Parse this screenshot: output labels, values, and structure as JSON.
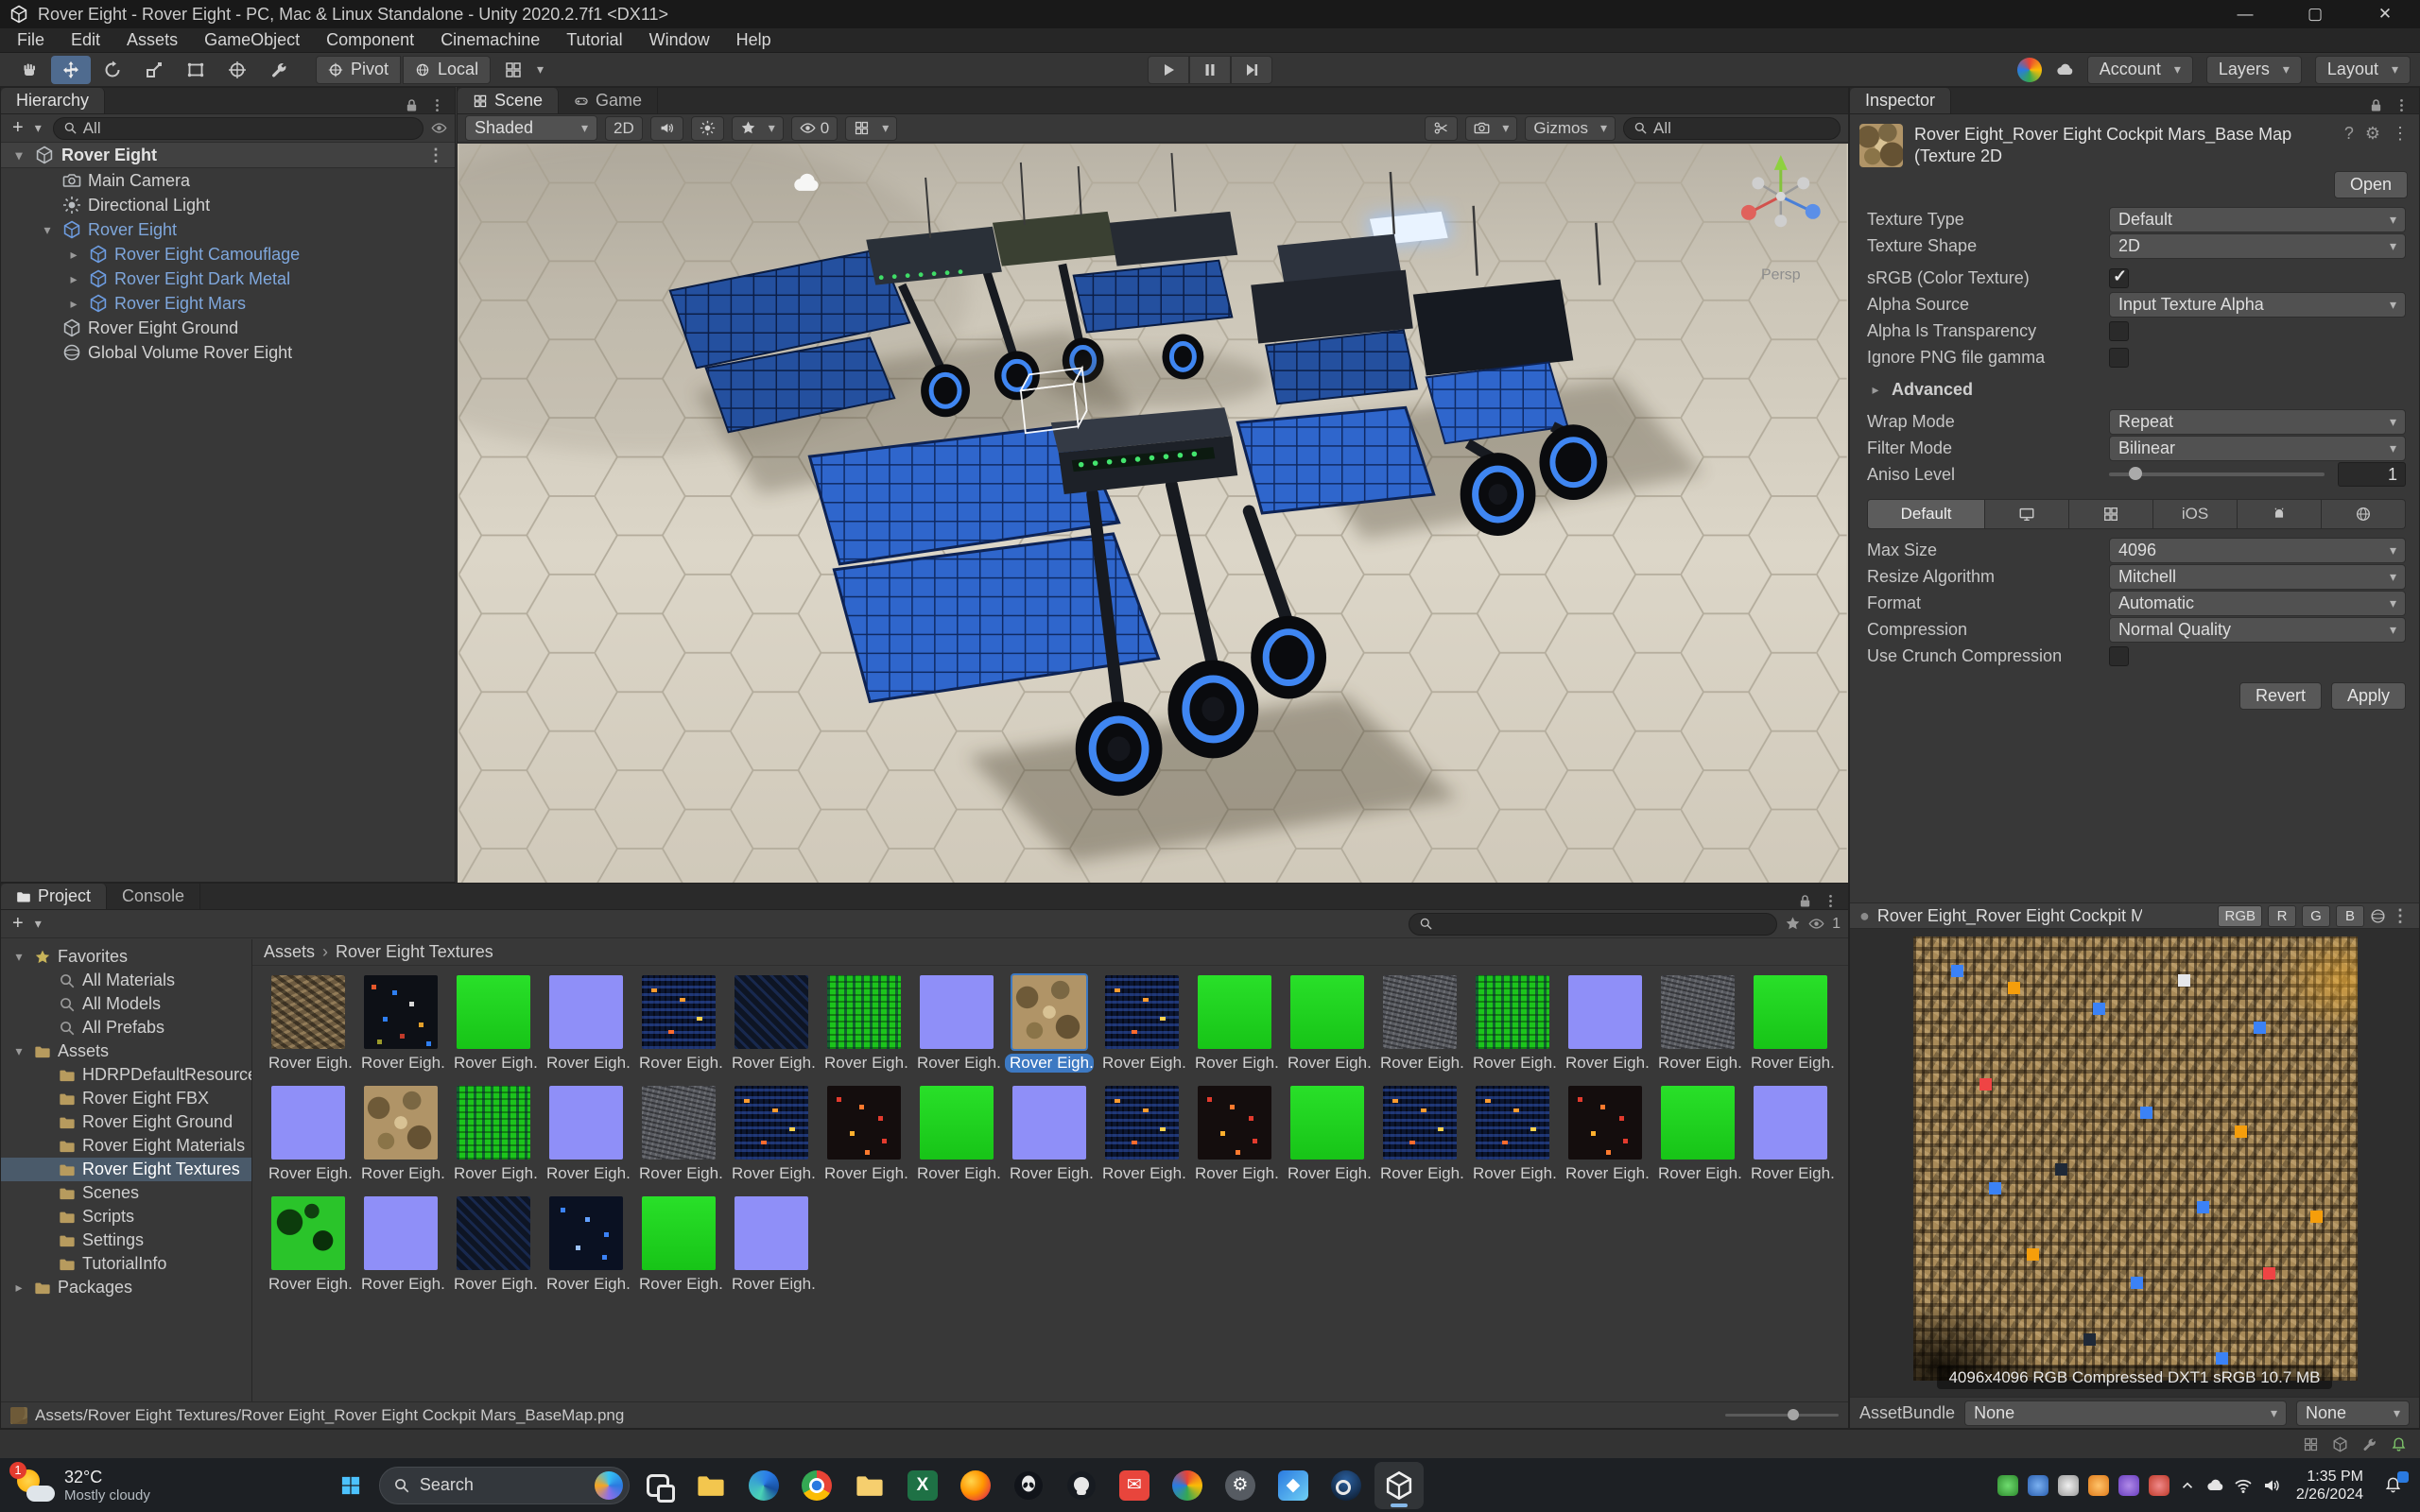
{
  "window": {
    "title": "Rover Eight - Rover Eight - PC, Mac & Linux Standalone - Unity 2020.2.7f1 <DX11>"
  },
  "menu": {
    "items": [
      "File",
      "Edit",
      "Assets",
      "GameObject",
      "Component",
      "Cinemachine",
      "Tutorial",
      "Window",
      "Help"
    ]
  },
  "toolbar": {
    "pivot": "Pivot",
    "local": "Local",
    "account": "Account",
    "layers": "Layers",
    "layout": "Layout"
  },
  "hierarchy": {
    "tab": "Hierarchy",
    "search_value": "All",
    "scene_name": "Rover Eight",
    "items": [
      {
        "label": "Main Camera",
        "icon": "camera",
        "depth": 1,
        "expander": "none",
        "prefab": false
      },
      {
        "label": "Directional Light",
        "icon": "light",
        "depth": 1,
        "expander": "none",
        "prefab": false
      },
      {
        "label": "Rover Eight",
        "icon": "cube",
        "depth": 1,
        "expander": "open",
        "prefab": true
      },
      {
        "label": "Rover Eight Camouflage",
        "icon": "cube",
        "depth": 2,
        "expander": "closed",
        "prefab": true
      },
      {
        "label": "Rover Eight Dark Metal",
        "icon": "cube",
        "depth": 2,
        "expander": "closed",
        "prefab": true
      },
      {
        "label": "Rover Eight Mars",
        "icon": "cube",
        "depth": 2,
        "expander": "closed",
        "prefab": true
      },
      {
        "label": "Rover Eight Ground",
        "icon": "cube",
        "depth": 1,
        "expander": "none",
        "prefab": false
      },
      {
        "label": "Global Volume Rover Eight",
        "icon": "sphere",
        "depth": 1,
        "expander": "none",
        "prefab": false
      }
    ]
  },
  "scene": {
    "tab_scene": "Scene",
    "tab_game": "Game",
    "shading": "Shaded",
    "toggle_2d": "2D",
    "fx_count": "0",
    "gizmos": "Gizmos",
    "search_value": "All",
    "persp_label": "Persp"
  },
  "inspector": {
    "tab": "Inspector",
    "title": "Rover Eight_Rover Eight Cockpit Mars_Base Map (Texture 2D",
    "open_button": "Open",
    "texture_type_label": "Texture Type",
    "texture_type": "Default",
    "texture_shape_label": "Texture Shape",
    "texture_shape": "2D",
    "srgb_label": "sRGB (Color Texture)",
    "alpha_source_label": "Alpha Source",
    "alpha_source": "Input Texture Alpha",
    "alpha_transparency_label": "Alpha Is Transparency",
    "ignore_png_label": "Ignore PNG file gamma",
    "advanced_label": "Advanced",
    "wrap_mode_label": "Wrap Mode",
    "wrap_mode": "Repeat",
    "filter_mode_label": "Filter Mode",
    "filter_mode": "Bilinear",
    "aniso_label": "Aniso Level",
    "aniso_value": "1",
    "platform_default": "Default",
    "max_size_label": "Max Size",
    "max_size": "4096",
    "resize_label": "Resize Algorithm",
    "resize": "Mitchell",
    "format_label": "Format",
    "format": "Automatic",
    "compression_label": "Compression",
    "compression": "Normal Quality",
    "crunch_label": "Use Crunch Compression",
    "revert": "Revert",
    "apply": "Apply"
  },
  "preview": {
    "title": "Rover Eight_Rover Eight Cockpit Ma",
    "channels": [
      "RGB",
      "R",
      "G",
      "B"
    ],
    "caption": "4096x4096  RGB Compressed DXT1 sRGB  10.7 MB",
    "assetbundle_label": "AssetBundle",
    "assetbundle_value": "None",
    "assetbundle_variant": "None"
  },
  "project": {
    "tab_project": "Project",
    "tab_console": "Console",
    "favorites_label": "Favorites",
    "favorites": [
      "All Materials",
      "All Models",
      "All Prefabs"
    ],
    "assets_label": "Assets",
    "folders": [
      "HDRPDefaultResources",
      "Rover Eight FBX",
      "Rover Eight Ground",
      "Rover Eight Materials",
      "Rover Eight Textures",
      "Scenes",
      "Scripts",
      "Settings",
      "TutorialInfo"
    ],
    "selected_folder": "Rover Eight Textures",
    "packages_label": "Packages",
    "breadcrumb_root": "Assets",
    "breadcrumb_current": "Rover Eight Textures",
    "item_label": "Rover Eigh...",
    "hidden_count": "1",
    "grid_variants": [
      "rock",
      "darkdots",
      "green",
      "purple",
      "bluetech",
      "darkblue",
      "greentech",
      "purple",
      "camo",
      "bluetech",
      "green",
      "green",
      "noise",
      "greentech",
      "purple",
      "noise",
      "green",
      "purple",
      "camo",
      "greentech",
      "purple",
      "noise",
      "bluetech",
      "reddots",
      "green",
      "purple",
      "bluetech",
      "reddots",
      "green",
      "bluetech",
      "bluetech",
      "reddots",
      "green",
      "purple",
      "greencamo",
      "purple",
      "darkblue",
      "bluedots",
      "green",
      "purple"
    ],
    "selected_index": 8,
    "status_path": "Assets/Rover Eight Textures/Rover Eight_Rover Eight Cockpit Mars_BaseMap.png"
  },
  "taskbar": {
    "weather_temp": "32°C",
    "weather_desc": "Mostly cloudy",
    "weather_badge": "1",
    "search_label": "Search",
    "apps": [
      "taskview",
      "file-explorer",
      "edge",
      "chrome",
      "folder",
      "excel",
      "firefox",
      "alienware",
      "github",
      "mail",
      "browser",
      "settings",
      "photos",
      "steam",
      "unity"
    ],
    "time": "1:35 PM",
    "date": "2/26/2024"
  }
}
